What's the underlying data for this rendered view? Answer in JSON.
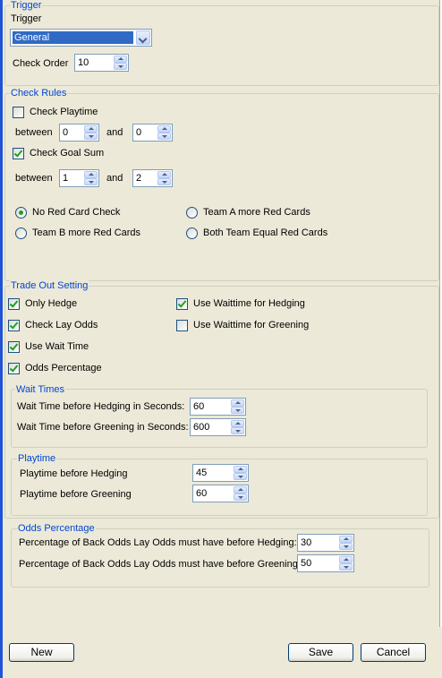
{
  "trigger": {
    "legend": "Trigger",
    "trigger_label": "Trigger",
    "trigger_value": "General",
    "check_order_label": "Check Order",
    "check_order_value": "10"
  },
  "check_rules": {
    "legend": "Check Rules",
    "check_playtime": {
      "label": "Check Playtime",
      "checked": false
    },
    "playtime_between_label": "between",
    "playtime_from": "0",
    "playtime_and_label": "and",
    "playtime_to": "0",
    "check_goal_sum": {
      "label": "Check Goal Sum",
      "checked": true
    },
    "goal_between_label": "between",
    "goal_from": "1",
    "goal_and_label": "and",
    "goal_to": "2",
    "red_card_options": [
      {
        "label": "No Red Card Check",
        "selected": true
      },
      {
        "label": "Team A more Red Cards",
        "selected": false
      },
      {
        "label": "Team B more Red Cards",
        "selected": false
      },
      {
        "label": "Both Team Equal Red Cards",
        "selected": false
      }
    ]
  },
  "trade_out": {
    "legend": "Trade Out Setting",
    "only_hedge": {
      "label": "Only Hedge",
      "checked": true
    },
    "use_waittime_hedging": {
      "label": "Use Waittime for Hedging",
      "checked": true
    },
    "check_lay_odds": {
      "label": "Check Lay Odds",
      "checked": true
    },
    "use_waittime_greening": {
      "label": "Use Waittime for Greening",
      "checked": false
    },
    "use_wait_time": {
      "label": "Use Wait Time",
      "checked": true
    },
    "odds_percentage": {
      "label": "Odds Percentage",
      "checked": true
    },
    "wait_times": {
      "legend": "Wait Times",
      "hedging_label": "Wait Time before Hedging in Seconds:",
      "hedging_value": "60",
      "greening_label": "Wait Time before Greening in Seconds:",
      "greening_value": "600"
    },
    "playtime": {
      "legend": "Playtime",
      "hedging_label": "Playtime before Hedging",
      "hedging_value": "45",
      "greening_label": "Playtime before Greening",
      "greening_value": "60"
    },
    "odds_pct": {
      "legend": "Odds Percentage",
      "hedging_label": "Percentage of Back Odds Lay Odds must have before Hedging:",
      "hedging_value": "30",
      "greening_label": "Percentage of Back Odds Lay Odds must have before Greening:",
      "greening_value": "50"
    }
  },
  "buttons": {
    "new": "New",
    "save": "Save",
    "cancel": "Cancel"
  },
  "colors": {
    "window_bg": "#ECE9D8",
    "legend_text": "#0046D5",
    "check_mark": "#21A121",
    "selection": "#316AC5"
  }
}
